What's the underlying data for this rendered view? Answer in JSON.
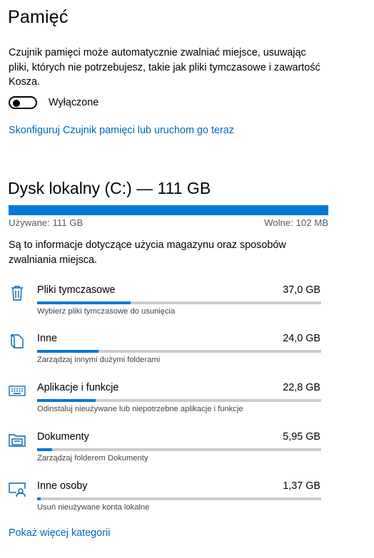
{
  "page": {
    "title": "Pamięć",
    "description": "Czujnik pamięci może automatycznie zwalniać miejsce, usuwając pliki, których nie potrzebujesz, takie jak pliki tymczasowe i zawartość Kosza.",
    "toggle": {
      "state": "off",
      "label": "Wyłączone"
    },
    "configure_link": "Skonfiguruj Czujnik pamięci lub uruchom go teraz"
  },
  "disk": {
    "title": "Dysk lokalny (C:) — 111 GB",
    "used_label": "Używane: 111 GB",
    "free_label": "Wolne: 102 MB",
    "used_fraction": 1.0,
    "info": "Są to informacje dotyczące użycia magazynu oraz sposobów zwalniania miejsca."
  },
  "categories": [
    {
      "name": "Pliki tymczasowe",
      "size": "37,0 GB",
      "subtitle": "Wybierz pliki tymczasowe do usunięcia",
      "icon": "trash-icon",
      "fraction": 0.33
    },
    {
      "name": "Inne",
      "size": "24,0 GB",
      "subtitle": "Zarządzaj innymi dużymi folderami",
      "icon": "other-files-icon",
      "fraction": 0.215
    },
    {
      "name": "Aplikacje i funkcje",
      "size": "22,8 GB",
      "subtitle": "Odinstaluj nieużywane lub niepotrzebne aplikacje i funkcje",
      "icon": "keyboard-icon",
      "fraction": 0.205
    },
    {
      "name": "Dokumenty",
      "size": "5,95 GB",
      "subtitle": "Zarządzaj folderem Dokumenty",
      "icon": "documents-folder-icon",
      "fraction": 0.053
    },
    {
      "name": "Inne osoby",
      "size": "1,37 GB",
      "subtitle": "Usuń nieużywane konta lokalne",
      "icon": "other-users-icon",
      "fraction": 0.013
    }
  ],
  "more_link": "Pokaż więcej kategorii",
  "colors": {
    "accent": "#0078d7",
    "link": "#0067c0",
    "track": "#cccccc"
  }
}
